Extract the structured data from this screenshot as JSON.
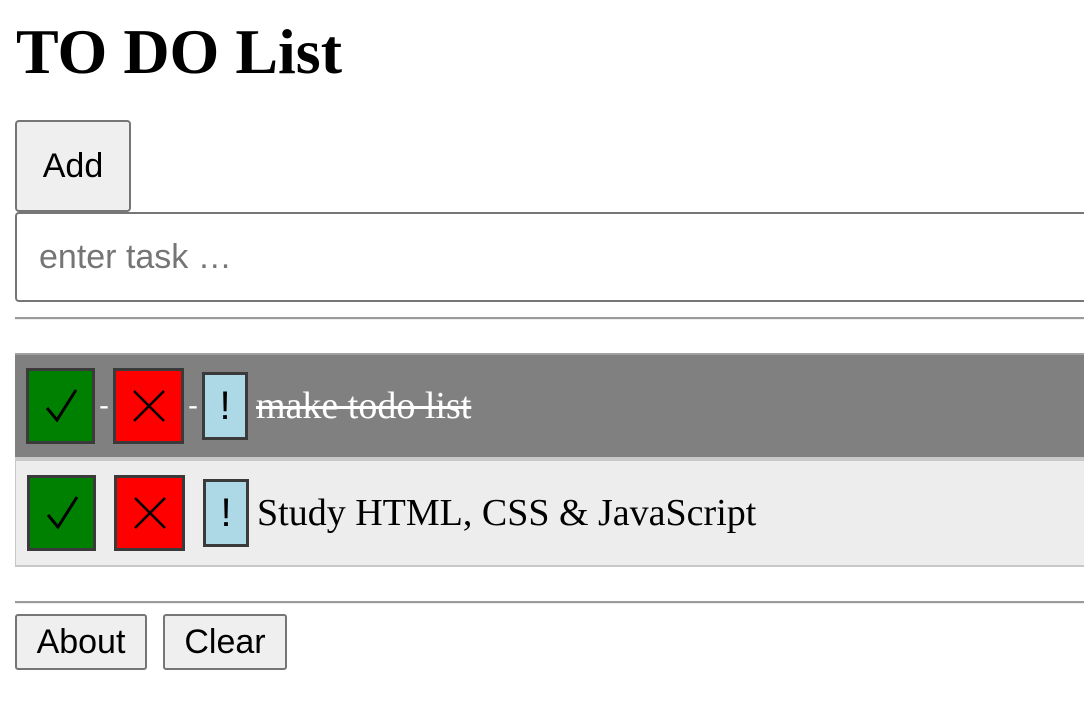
{
  "page": {
    "title": "TO DO List"
  },
  "form": {
    "add_label": "Add",
    "input_value": "",
    "input_placeholder": "enter task …"
  },
  "tasks": [
    {
      "text": "make todo list",
      "status": "completed",
      "separator": "-",
      "priority_label": "!",
      "check_icon": "check-icon",
      "delete_icon": "cross-icon",
      "row_color": "#808080"
    },
    {
      "text": "Study HTML, CSS & JavaScript",
      "status": "open",
      "separator": "-",
      "priority_label": "!",
      "check_icon": "check-icon",
      "delete_icon": "cross-icon",
      "row_color": "#ededed"
    }
  ],
  "footer": {
    "about_label": "About",
    "clear_label": "Clear"
  },
  "colors": {
    "check_button": "#008000",
    "delete_button": "#ff0000",
    "priority_button": "#add8e6",
    "completed_row": "#808080",
    "open_row": "#ededed"
  }
}
